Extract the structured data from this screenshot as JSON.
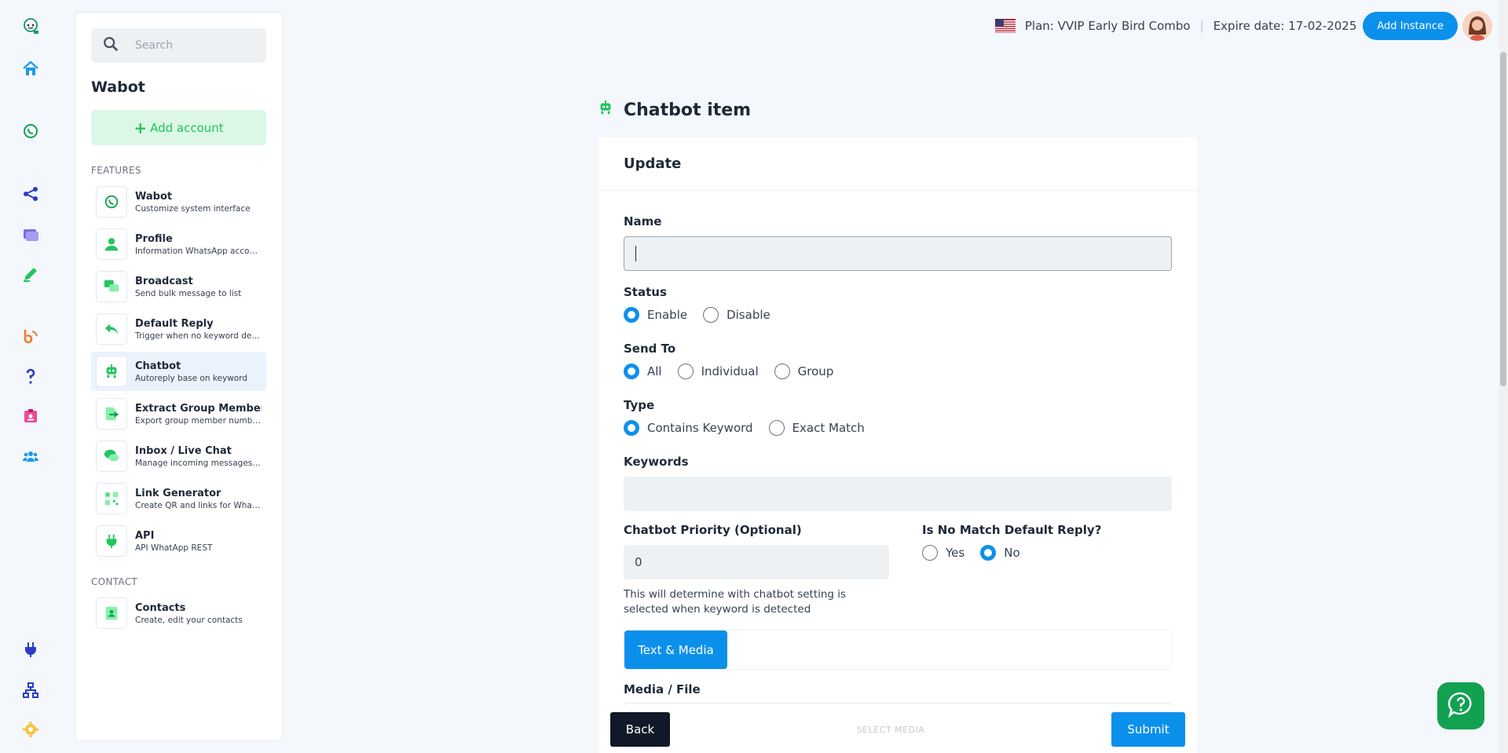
{
  "sidebar": {
    "search_placeholder": "Search",
    "title": "Wabot",
    "add_account_label": "Add account",
    "features_label": "FEATURES",
    "contact_label": "CONTACT",
    "features": [
      {
        "name": "Wabot",
        "desc": "Customize system interface"
      },
      {
        "name": "Profile",
        "desc": "Information WhatsApp account"
      },
      {
        "name": "Broadcast",
        "desc": "Send bulk message to list"
      },
      {
        "name": "Default Reply",
        "desc": "Trigger when no keyword detected"
      },
      {
        "name": "Chatbot",
        "desc": "Autoreply base on keyword"
      },
      {
        "name": "Extract Group Member",
        "desc": "Export group member number"
      },
      {
        "name": "Inbox / Live Chat",
        "desc": "Manage incoming messages and chats"
      },
      {
        "name": "Link Generator",
        "desc": "Create QR and links for WhatsApp"
      },
      {
        "name": "API",
        "desc": "API WhatApp REST"
      }
    ],
    "contacts": [
      {
        "name": "Contacts",
        "desc": "Create, edit your contacts"
      }
    ]
  },
  "topbar": {
    "plan": "Plan: VVIP Early Bird Combo",
    "separator": "|",
    "expire": "Expire date: 17-02-2025",
    "add_instance_label": "Add Instance"
  },
  "main": {
    "page_title": "Chatbot item",
    "card_title": "Update",
    "name_label": "Name",
    "name_value": "",
    "status_label": "Status",
    "status_options": [
      "Enable",
      "Disable"
    ],
    "status_selected": "Enable",
    "send_to_label": "Send To",
    "send_to_options": [
      "All",
      "Individual",
      "Group"
    ],
    "send_to_selected": "All",
    "type_label": "Type",
    "type_options": [
      "Contains Keyword",
      "Exact Match"
    ],
    "type_selected": "Contains Keyword",
    "keywords_label": "Keywords",
    "keywords_value": "",
    "priority_label": "Chatbot Priority (Optional)",
    "priority_value": "0",
    "priority_help": "This will determine with chatbot setting is selected when keyword is detected",
    "default_reply_label": "Is No Match Default Reply?",
    "default_reply_options": [
      "Yes",
      "No"
    ],
    "default_reply_selected": "No",
    "tab_active": "Text & Media",
    "media_label": "Media / File"
  },
  "footer": {
    "back_label": "Back",
    "select_media_label": "SELECT MEDIA",
    "submit_label": "Submit"
  },
  "colors": {
    "primary": "#0b90ec",
    "green": "#22c55e",
    "dark": "#111827"
  }
}
